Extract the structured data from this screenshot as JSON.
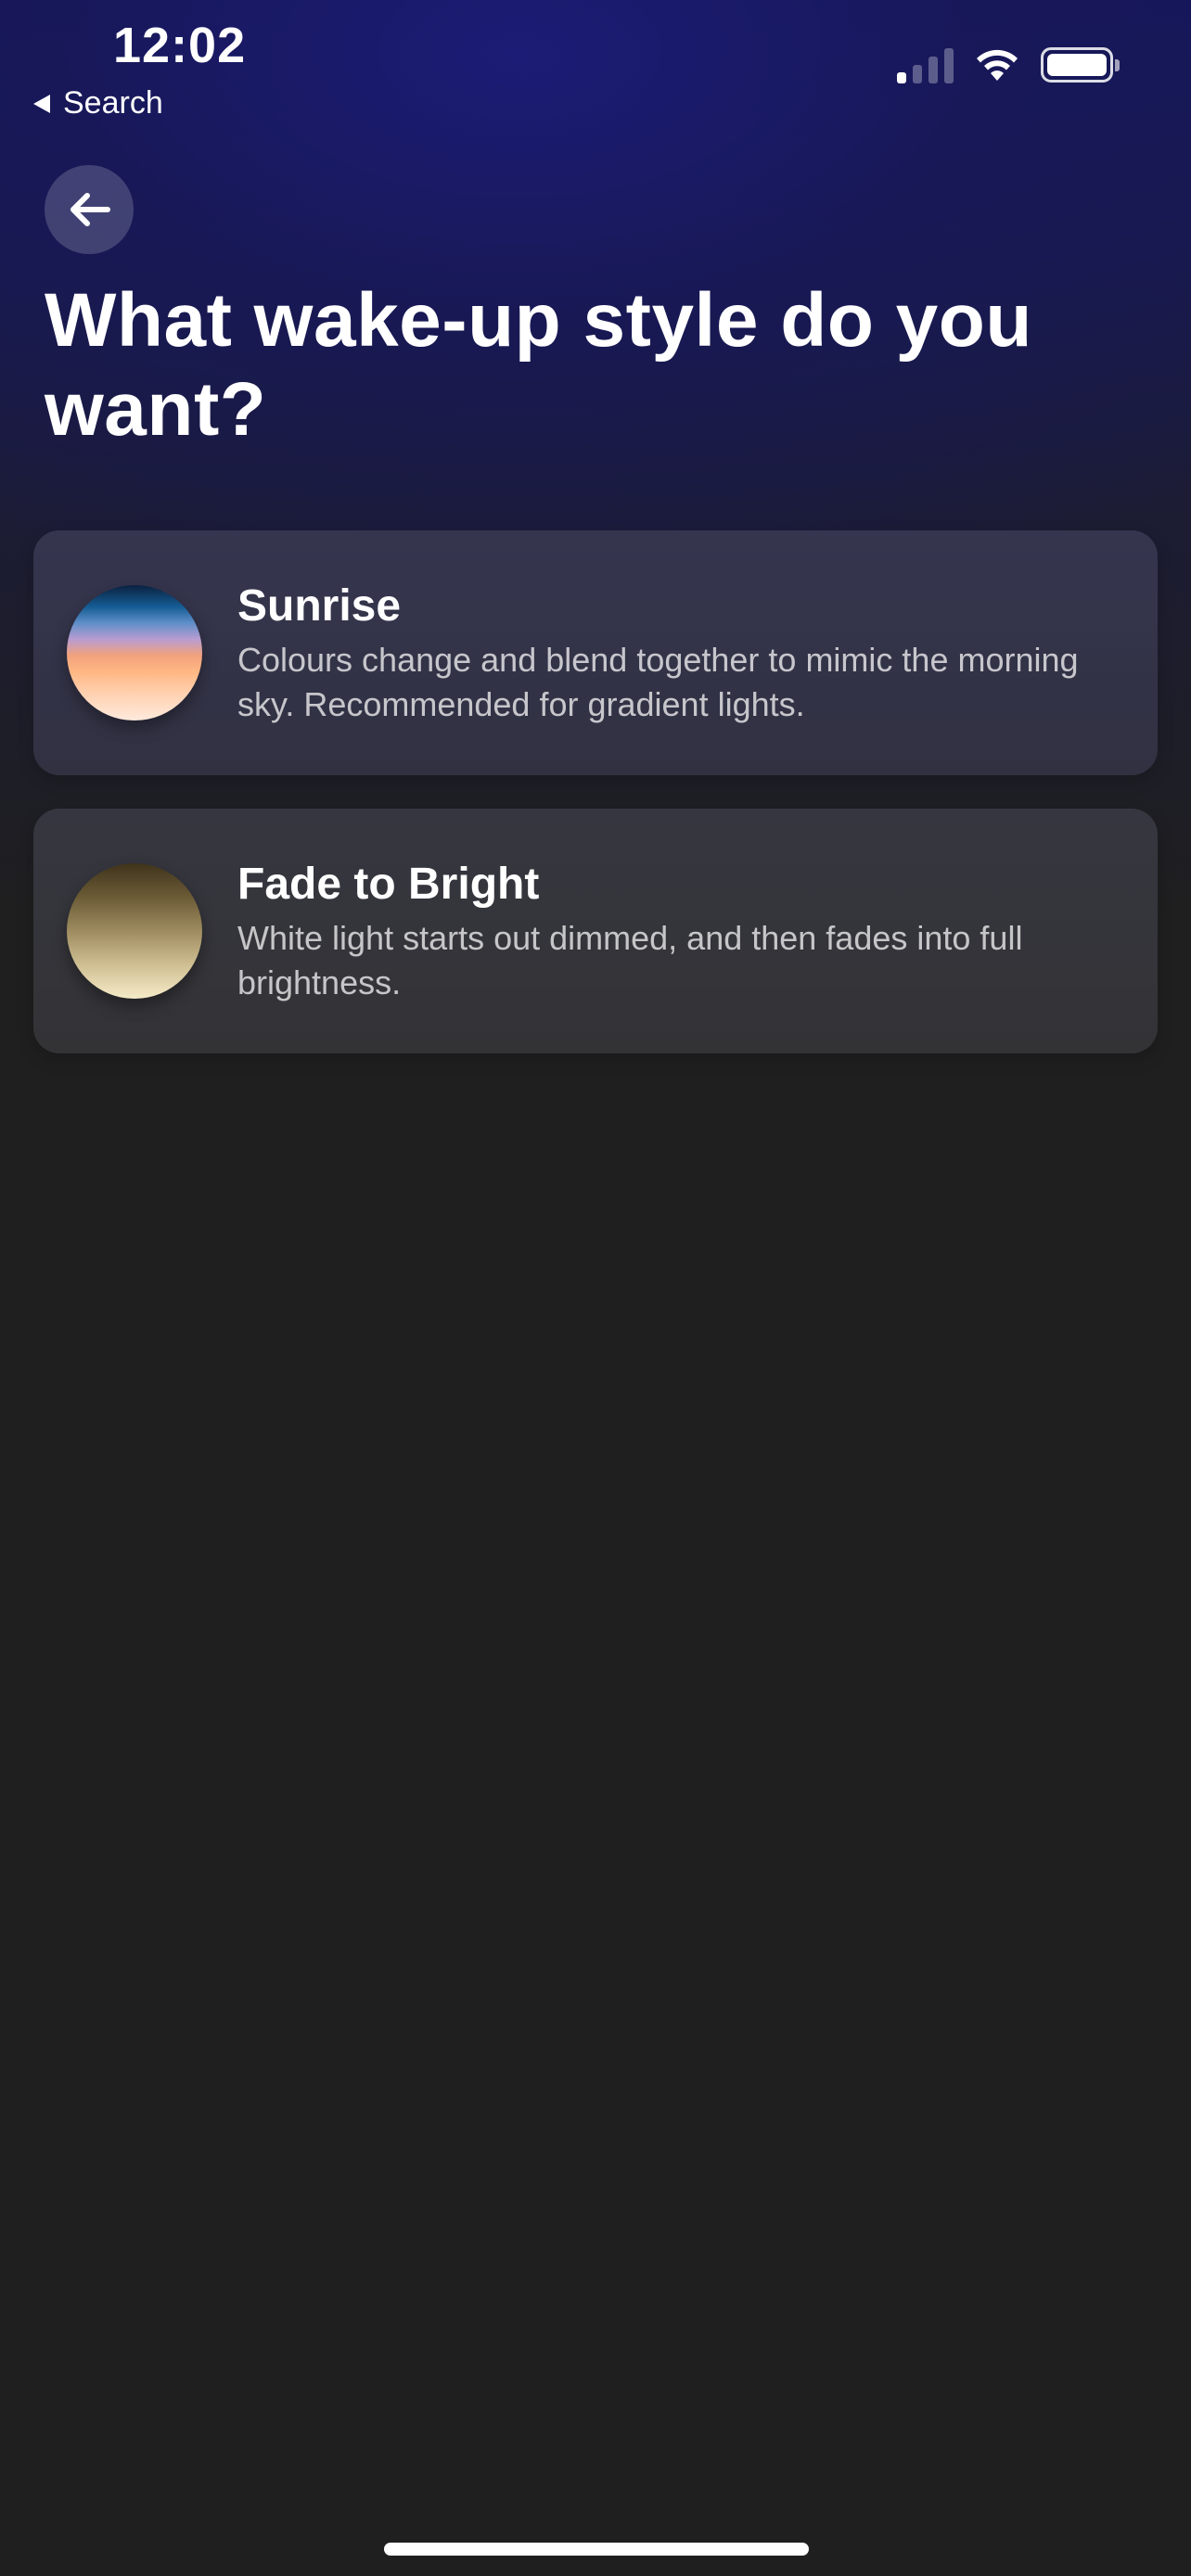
{
  "status_bar": {
    "time": "12:02",
    "back_label": "Search"
  },
  "header": {
    "title": "What wake-up style do you want?"
  },
  "options": [
    {
      "title": "Sunrise",
      "description": "Colours change and blend together to mimic the morning sky. Recommended for gradient lights."
    },
    {
      "title": "Fade to Bright",
      "description": "White light starts out dimmed, and then fades into full brightness."
    }
  ],
  "icons": {
    "back": "arrow-left-icon",
    "signal": "cellular-signal-icon",
    "wifi": "wifi-icon",
    "battery": "battery-icon"
  },
  "colors": {
    "background": "#1f1f1f",
    "header_glow": "#15165a",
    "card_background": "#333336"
  }
}
